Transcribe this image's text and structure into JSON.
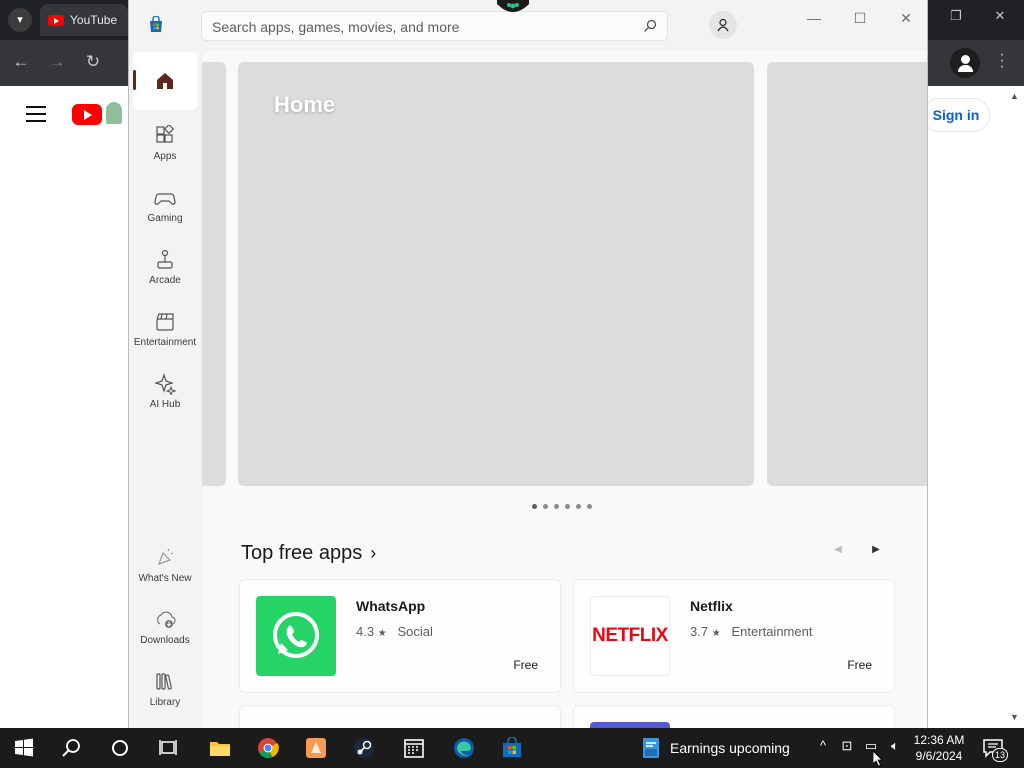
{
  "browser": {
    "tab_title": "YouTube",
    "sign_in_label": "Sign in",
    "tab_search_icon": "chevron-down-icon",
    "window_controls": [
      "restore-icon",
      "close-icon"
    ]
  },
  "store": {
    "search": {
      "placeholder": "Search apps, games, movies, and more"
    },
    "window_controls": [
      "minimize-icon",
      "maximize-icon",
      "close-icon"
    ],
    "nav": {
      "items": [
        {
          "label": "",
          "icon": "home-icon"
        },
        {
          "label": "Apps",
          "icon": "apps-icon"
        },
        {
          "label": "Gaming",
          "icon": "gaming-icon"
        },
        {
          "label": "Arcade",
          "icon": "arcade-icon"
        },
        {
          "label": "Entertainment",
          "icon": "entertainment-icon"
        },
        {
          "label": "AI Hub",
          "icon": "ai-hub-icon"
        }
      ],
      "bottom_items": [
        {
          "label": "What's New",
          "icon": "whats-new-icon"
        },
        {
          "label": "Downloads",
          "icon": "downloads-icon"
        },
        {
          "label": "Library",
          "icon": "library-icon"
        }
      ]
    },
    "hero": {
      "title": "Home",
      "slides": 6,
      "active_slide": 1
    },
    "section": {
      "title": "Top free apps",
      "chevron": "›"
    },
    "apps": [
      {
        "name": "WhatsApp",
        "rating": "4.3",
        "star": "★",
        "category": "Social",
        "price": "Free",
        "icon_color": "#25d366"
      },
      {
        "name": "Netflix",
        "rating": "3.7",
        "star": "★",
        "category": "Entertainment",
        "price": "Free",
        "logo_text": "NETFLIX",
        "icon_color": "#e50914"
      }
    ]
  },
  "taskbar": {
    "news_text": "Earnings upcoming",
    "time": "12:36 AM",
    "date": "9/6/2024",
    "notification_count": "13"
  }
}
